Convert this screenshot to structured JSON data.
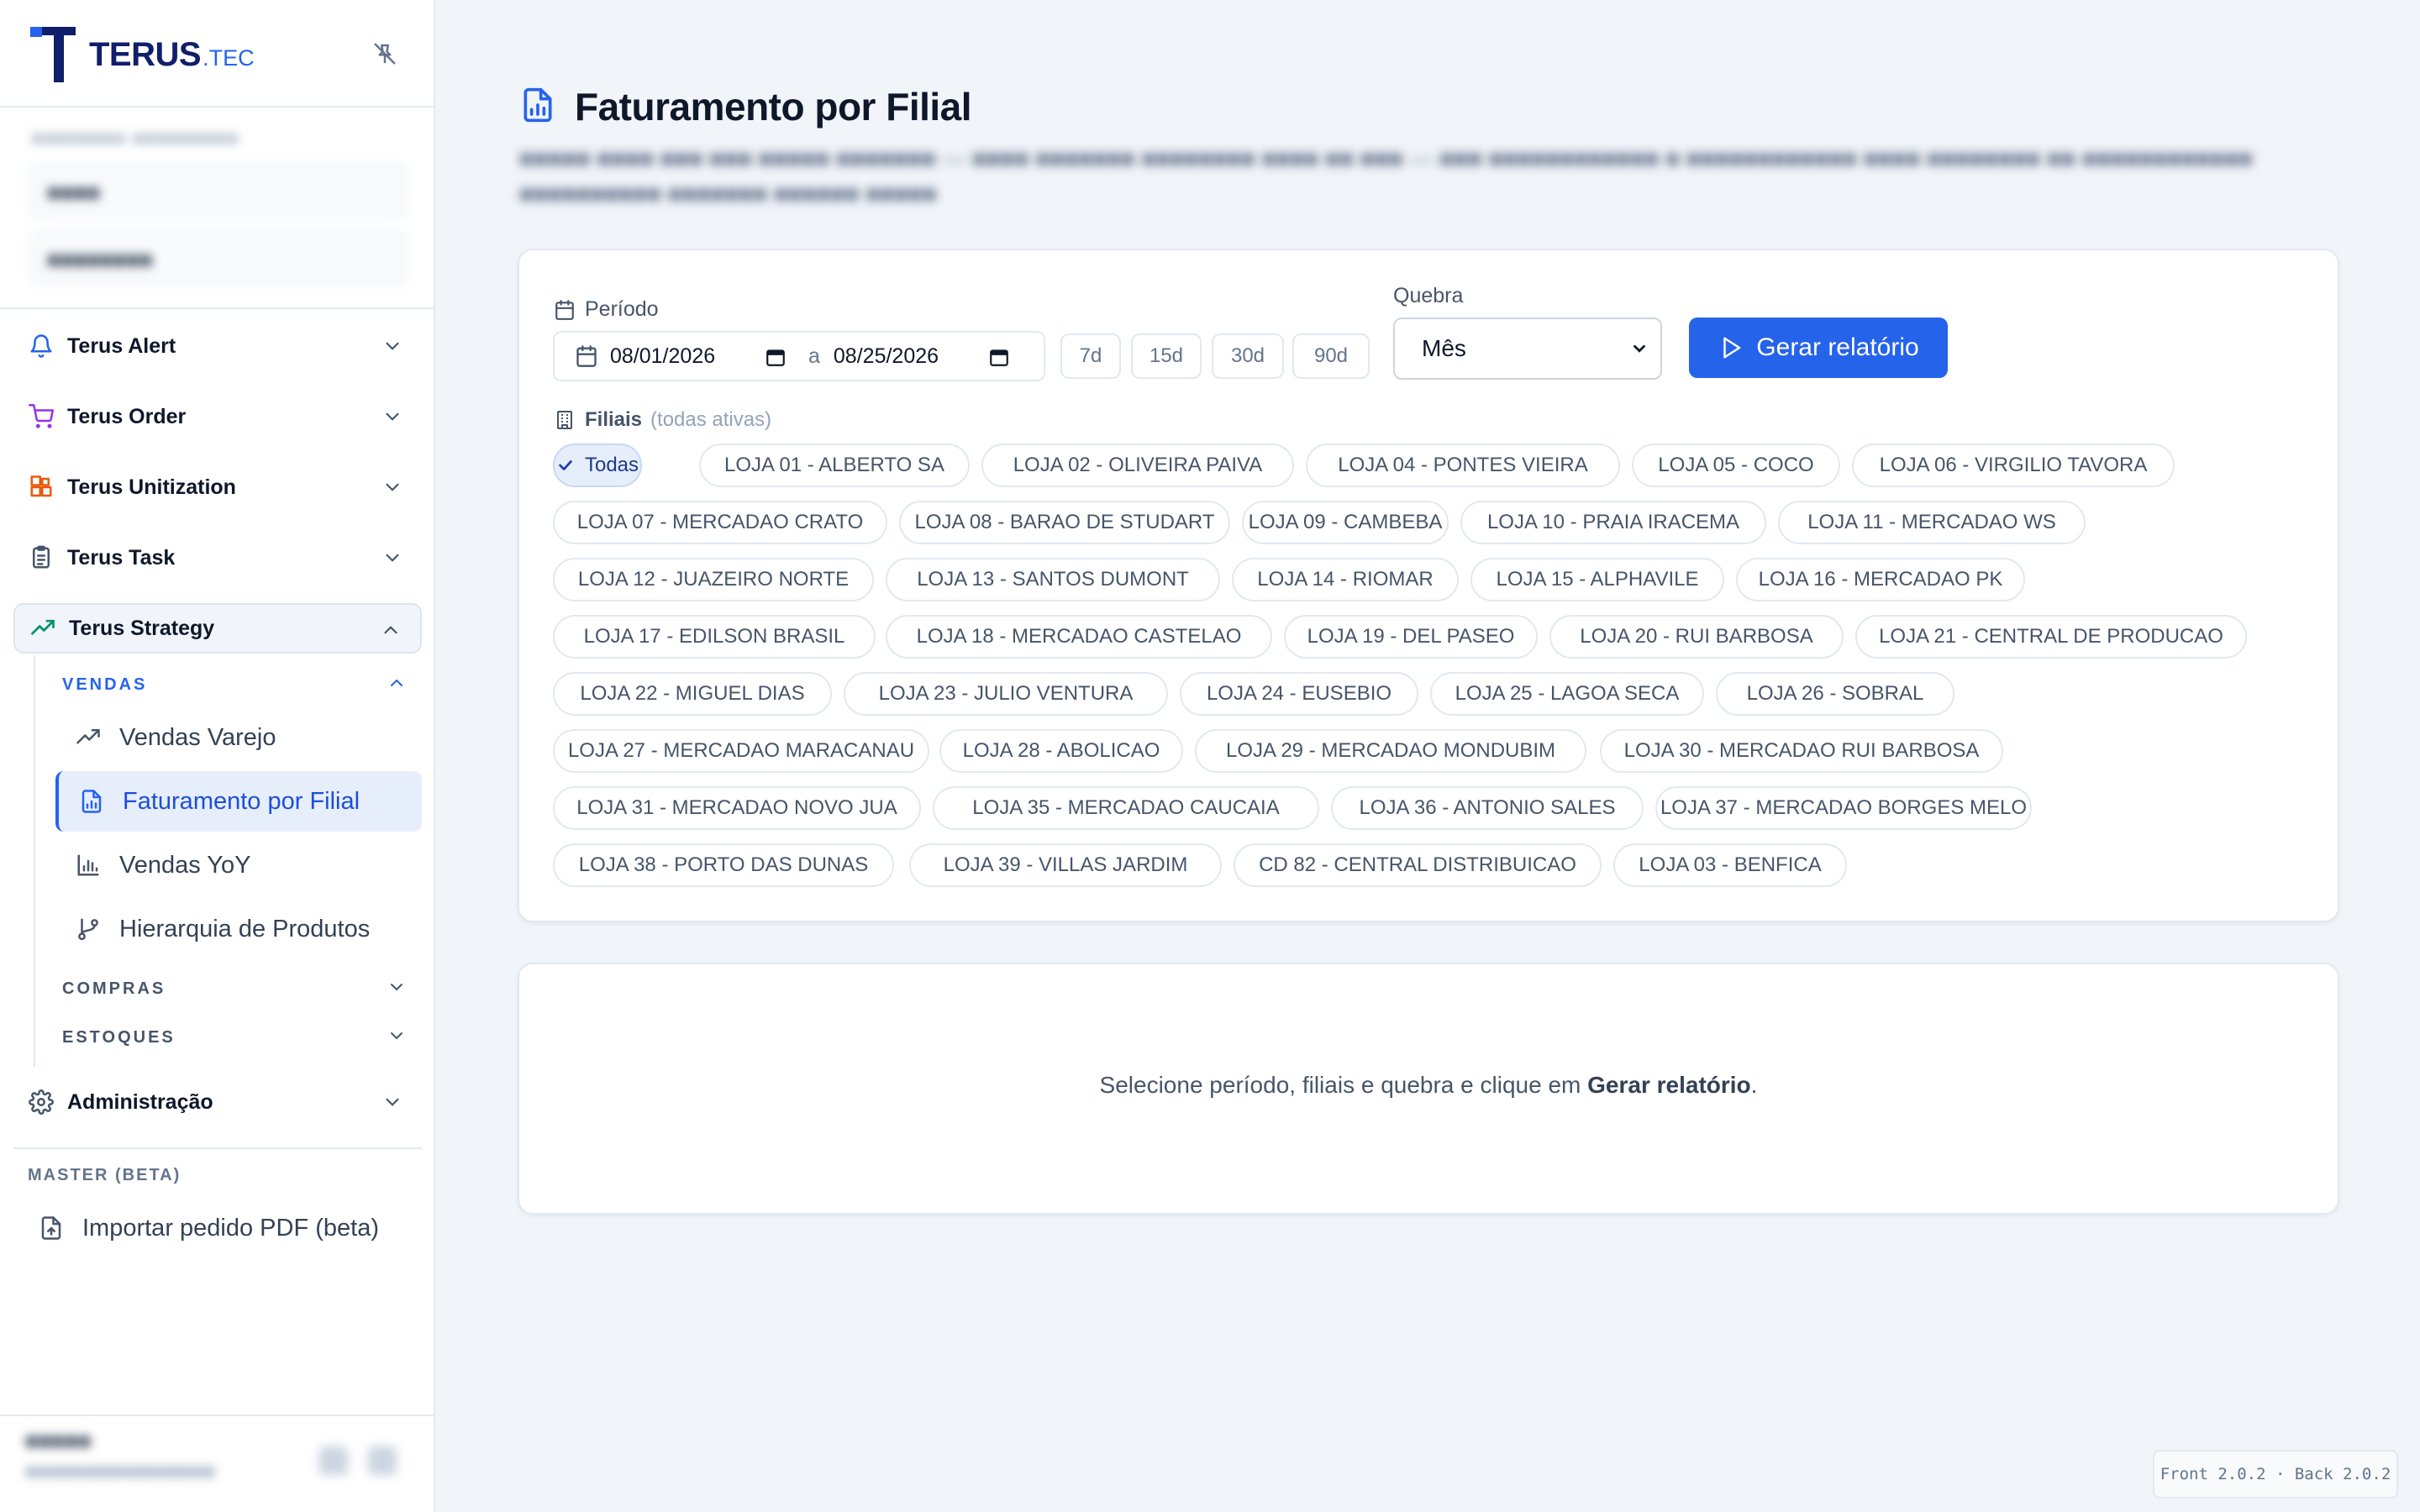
{
  "brand": {
    "name": "TERUS",
    "suffix": ".TEC",
    "colors": {
      "primary": "#0f1f6b",
      "accent": "#2563eb"
    }
  },
  "sidebar": {
    "nav": [
      {
        "label": "Terus Alert",
        "icon": "bell-icon"
      },
      {
        "label": "Terus Order",
        "icon": "cart-icon"
      },
      {
        "label": "Terus Unitization",
        "icon": "boxes-icon"
      },
      {
        "label": "Terus Task",
        "icon": "clipboard-icon"
      },
      {
        "label": "Terus Strategy",
        "icon": "trending-up-icon"
      }
    ],
    "strategy_sections": {
      "vendas": "VENDAS",
      "compras": "COMPRAS",
      "estoques": "ESTOQUES"
    },
    "vendas_items": [
      {
        "label": "Vendas Varejo",
        "icon": "trending-up-icon"
      },
      {
        "label": "Faturamento por Filial",
        "icon": "report-icon"
      },
      {
        "label": "Vendas YoY",
        "icon": "bar-chart-icon"
      },
      {
        "label": "Hierarquia de Produtos",
        "icon": "git-branch-icon"
      }
    ],
    "admin_label": "Administração",
    "master_label": "MASTER (BETA)",
    "import_label": "Importar pedido PDF (beta)"
  },
  "page": {
    "title": "Faturamento por Filial"
  },
  "filters": {
    "periodo_label": "Período",
    "date_from": "08/01/2026",
    "date_separator": "a",
    "date_to": "08/25/2026",
    "quick_ranges": [
      "7d",
      "15d",
      "30d",
      "90d"
    ],
    "quebra_label": "Quebra",
    "quebra_value": "Mês",
    "generate_label": "Gerar relatório",
    "filiais_label": "Filiais",
    "filiais_hint": "(todas ativas)",
    "branches": [
      "Todas",
      "LOJA 01 - ALBERTO SA",
      "LOJA 02 - OLIVEIRA PAIVA",
      "LOJA 04 - PONTES VIEIRA",
      "LOJA 05 - COCO",
      "LOJA 06 - VIRGILIO TAVORA",
      "LOJA 07 - MERCADAO CRATO",
      "LOJA 08 - BARAO DE STUDART",
      "LOJA 09 - CAMBEBA",
      "LOJA 10 - PRAIA IRACEMA",
      "LOJA 11 - MERCADAO WS",
      "LOJA 12 - JUAZEIRO NORTE",
      "LOJA 13 - SANTOS DUMONT",
      "LOJA 14 - RIOMAR",
      "LOJA 15 - ALPHAVILE",
      "LOJA 16 - MERCADAO PK",
      "LOJA 17 - EDILSON BRASIL",
      "LOJA 18 - MERCADAO CASTELAO",
      "LOJA 19 - DEL PASEO",
      "LOJA 20 - RUI BARBOSA",
      "LOJA 21 - CENTRAL DE PRODUCAO",
      "LOJA 22 - MIGUEL DIAS",
      "LOJA 23 - JULIO VENTURA",
      "LOJA 24 - EUSEBIO",
      "LOJA 25 - LAGOA SECA",
      "LOJA 26 - SOBRAL",
      "LOJA 27 - MERCADAO MARACANAU",
      "LOJA 28 - ABOLICAO",
      "LOJA 29 - MERCADAO MONDUBIM",
      "LOJA 30 - MERCADAO RUI BARBOSA",
      "LOJA 31 - MERCADAO NOVO JUA",
      "LOJA 35 - MERCADAO CAUCAIA",
      "LOJA 36 - ANTONIO SALES",
      "LOJA 37 - MERCADAO BORGES MELO",
      "LOJA 38 - PORTO DAS DUNAS",
      "LOJA 39 - VILLAS JARDIM",
      "CD 82 - CENTRAL DISTRIBUICAO",
      "LOJA 03 - BENFICA"
    ]
  },
  "result": {
    "message_prefix": "Selecione período, filiais e quebra e clique em ",
    "message_action": "Gerar relatório",
    "message_suffix": "."
  },
  "footer": {
    "version": "Front 2.0.2 · Back 2.0.2"
  }
}
